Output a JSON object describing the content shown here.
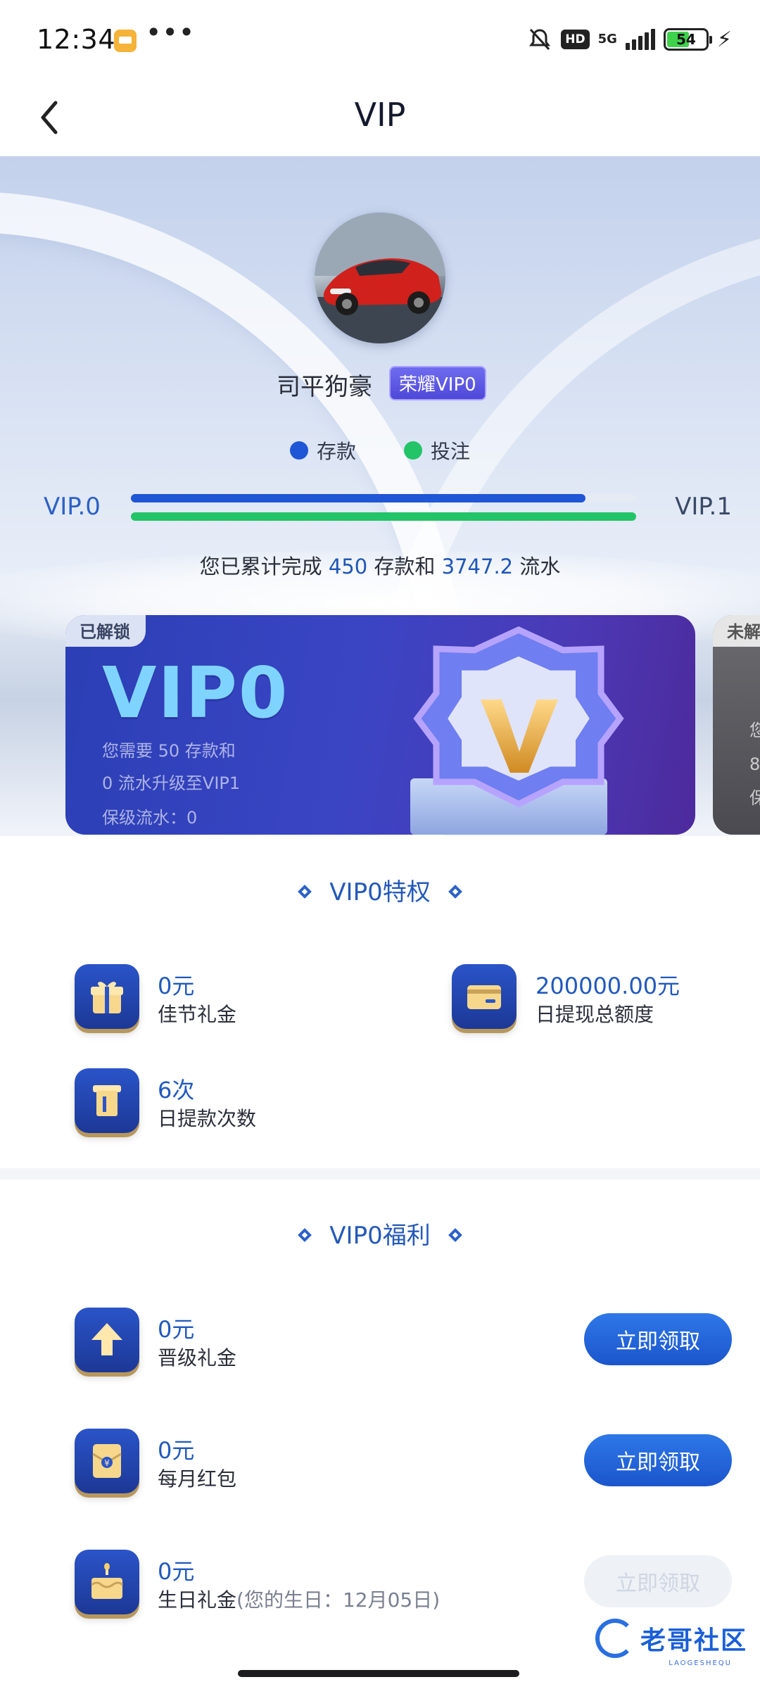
{
  "status_bar": {
    "time": "12:34",
    "dots": "•••",
    "hd": "HD",
    "network": "5G",
    "battery": "54"
  },
  "nav": {
    "title": "VIP"
  },
  "profile": {
    "username": "司平狗豪",
    "vip_badge": "荣耀VIP0"
  },
  "legend": [
    {
      "label": "存款",
      "color": "#1f56d6"
    },
    {
      "label": "投注",
      "color": "#22c467"
    }
  ],
  "progress": {
    "current_level": "VIP.0",
    "next_level": "VIP.1",
    "deposit_fraction": 0.9,
    "bet_fraction": 1.0,
    "summary_prefix": "您已累计完成",
    "deposit_count": "450",
    "summary_mid": "存款和",
    "turnover": "3747.2",
    "summary_suffix": "流水"
  },
  "cards": {
    "current": {
      "tag": "已解锁",
      "level": "VIP0",
      "req_line1": "您需要 50 存款和",
      "req_line2": "0 流水升级至VIP1",
      "keep": "保级流水：0"
    },
    "next": {
      "tag": "未解锁",
      "line1": "您",
      "line2": "8",
      "line3": "保"
    }
  },
  "privileges": {
    "title": "VIP0特权",
    "items": [
      {
        "value": "0元",
        "label": "佳节礼金",
        "icon": "gift-icon"
      },
      {
        "value": "200000.00元",
        "label": "日提现总额度",
        "icon": "card-icon"
      },
      {
        "value": "6次",
        "label": "日提款次数",
        "icon": "atm-icon"
      }
    ]
  },
  "benefits": {
    "title": "VIP0福利",
    "items": [
      {
        "value": "0元",
        "label": "晋级礼金",
        "button": "立即领取",
        "icon": "upgrade-arrow-icon",
        "enabled": true
      },
      {
        "value": "0元",
        "label": "每月红包",
        "button": "立即领取",
        "icon": "red-envelope-icon",
        "enabled": true
      },
      {
        "value": "0元",
        "label": "生日礼金",
        "note": "(您的生日：12月05日)",
        "button": "立即领取",
        "icon": "birthday-cake-icon",
        "enabled": false
      }
    ]
  },
  "watermark": {
    "text": "老哥社区",
    "sub": "LAOGESHEQU"
  }
}
